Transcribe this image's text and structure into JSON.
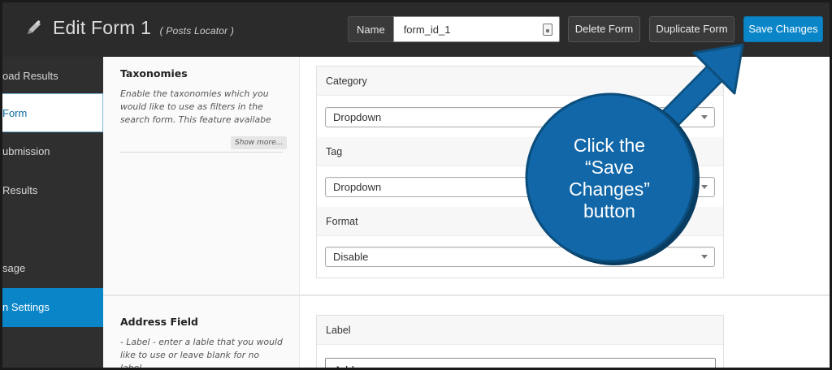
{
  "header": {
    "title": "Edit Form 1",
    "subtitle": "( Posts Locator )",
    "name_label": "Name",
    "name_value": "form_id_1",
    "delete_label": "Delete Form",
    "duplicate_label": "Duplicate Form",
    "save_label": "Save Changes"
  },
  "sidebar": {
    "items": [
      {
        "label": "oad Results"
      },
      {
        "label": "Form"
      },
      {
        "label": "ubmission"
      },
      {
        "label": "Results"
      },
      {
        "label": "sage"
      },
      {
        "label": "n Settings"
      }
    ]
  },
  "taxonomies": {
    "title": "Taxonomies",
    "description": "Enable the taxonomies which you would like to use as filters in the search form. This feature availabe",
    "show_more": "Show more...",
    "fields": [
      {
        "label": "Category",
        "value": "Dropdown"
      },
      {
        "label": "Tag",
        "value": "Dropdown"
      },
      {
        "label": "Format",
        "value": "Disable"
      }
    ]
  },
  "address_field": {
    "title": "Address Field",
    "description": "- Label - enter a lable that you would like to use or leave blank for no label.-",
    "label_heading": "Label",
    "label_value": "Address"
  },
  "callout": {
    "line1": "Click the",
    "line2": "“Save",
    "line3": "Changes”",
    "line4": "button",
    "color": "#1167a8"
  },
  "colors": {
    "accent": "#0a86c8",
    "header_bg": "#2b2b2b",
    "sidebar_bg": "#2f2f2f"
  }
}
